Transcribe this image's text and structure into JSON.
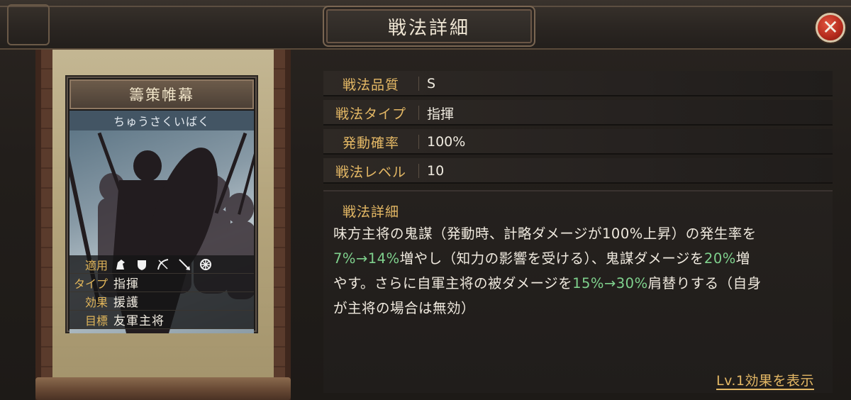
{
  "window": {
    "title": "戦法詳細"
  },
  "card": {
    "name": "籌策帷幕",
    "reading": "ちゅうさくいばく",
    "stats": [
      {
        "label": "適用",
        "value": ""
      },
      {
        "label": "タイプ",
        "value": "指揮"
      },
      {
        "label": "効果",
        "value": "援護"
      },
      {
        "label": "目標",
        "value": "友軍主将"
      }
    ],
    "unit_icons": [
      "cavalry-icon",
      "shield-icon",
      "bow-icon",
      "spear-icon",
      "wheel-icon"
    ]
  },
  "info": [
    {
      "label": "戦法品質",
      "value": "S"
    },
    {
      "label": "戦法タイプ",
      "value": "指揮"
    },
    {
      "label": "発動確率",
      "value": "100%"
    },
    {
      "label": "戦法レベル",
      "value": "10"
    }
  ],
  "detail": {
    "title": "戦法詳細",
    "line1": "味方主将の鬼謀（発動時、計略ダメージが100%上昇）の発生率を",
    "seg_a_green": "7%→14%",
    "seg_b": "増やし（知力の影響を受ける）、鬼謀ダメージを",
    "seg_c_green": "20%",
    "seg_d": "増",
    "seg_e": "やす。さらに自軍主将の被ダメージを",
    "seg_f_green": "15%→30%",
    "seg_g": "肩替りする（自身",
    "line4": "が主将の場合は無効）"
  },
  "link": {
    "label": "Lv.1効果を表示"
  },
  "colors": {
    "accent": "#e4b865",
    "green": "#7fd18d",
    "close": "#b32a1c"
  }
}
